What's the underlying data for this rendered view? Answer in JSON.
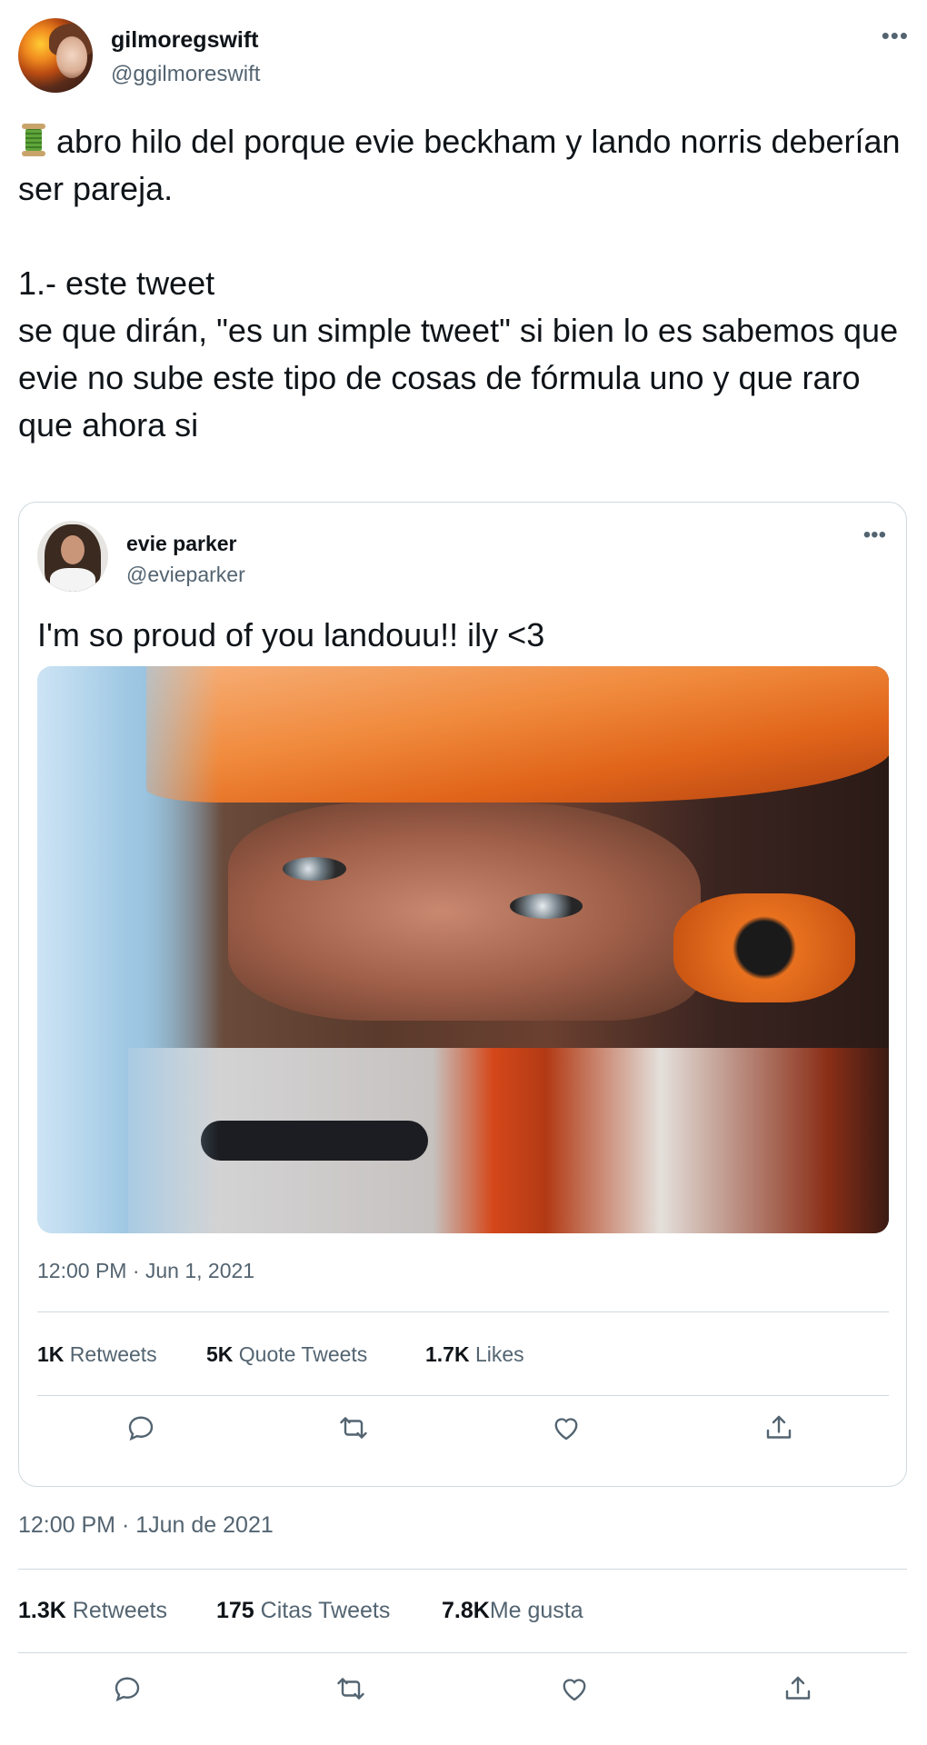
{
  "author": {
    "name": "gilmoregswift",
    "handle": "@ggilmoreswift"
  },
  "tweet": {
    "text_line1": "abro hilo del porque evie beckham y lando norris deberían ser pareja.",
    "text_line2": "1.- este tweet",
    "text_line3": "se que dirán, \"es un simple tweet\" si bien lo es sabemos que evie no sube este tipo de cosas de fórmula uno y que raro que ahora si",
    "timestamp": "12:00 PM · 1Jun de 2021",
    "stats": {
      "retweets_count": "1.3K",
      "retweets_label": "Retweets",
      "quotes_count": "175",
      "quotes_label": "Citas Tweets",
      "likes_count": "7.8K",
      "likes_label": "Me gusta"
    }
  },
  "quoted": {
    "name": "evie parker",
    "handle": "@evieparker",
    "text": "I'm so proud of you landouu!! ily <3",
    "timestamp": "12:00 PM · Jun 1, 2021",
    "stats": {
      "retweets_count": "1K",
      "retweets_label": "Retweets",
      "quotes_count": "5K",
      "quotes_label": "Quote Tweets",
      "likes_count": "1.7K",
      "likes_label": "Likes"
    }
  },
  "icons": {
    "thread": "spool-icon",
    "more": "more-options-icon",
    "reply": "reply-icon",
    "retweet": "retweet-icon",
    "like": "like-icon",
    "share": "share-icon"
  },
  "colors": {
    "text": "#0f1419",
    "secondary": "#536471",
    "border": "#cfd9de"
  },
  "ui": {
    "more_glyph": "•••"
  }
}
